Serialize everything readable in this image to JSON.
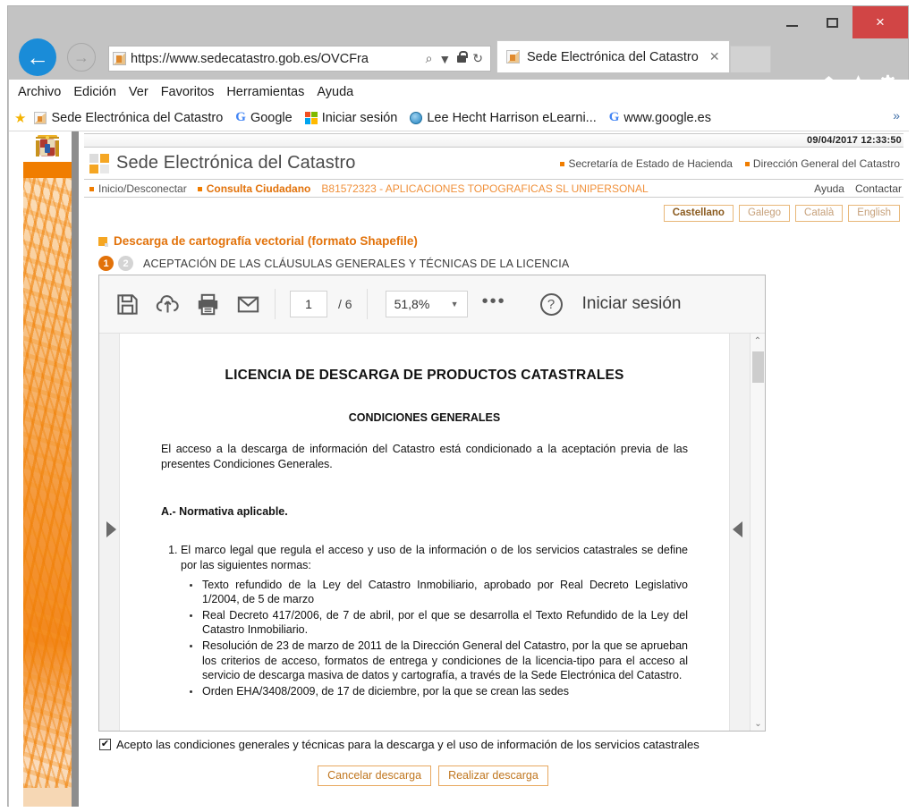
{
  "window": {
    "minimize_label": "minimize",
    "maximize_label": "maximize",
    "close_label": "×"
  },
  "browser": {
    "back_glyph": "←",
    "forward_glyph": "→",
    "address_value": "https://www.sedecatastro.gob.es/OVCFra",
    "address_placeholder": "",
    "search_glyph": "⌕",
    "caret_glyph": "▼",
    "refresh_glyph": "↻",
    "tab": {
      "title": "Sede Electrónica del Catastro",
      "close_glyph": "✕"
    },
    "tools": {
      "home_label": "Inicio",
      "favorites_label": "Favoritos",
      "settings_label": "Herramientas"
    },
    "menu": [
      "Archivo",
      "Edición",
      "Ver",
      "Favoritos",
      "Herramientas",
      "Ayuda"
    ],
    "bookmarks": [
      {
        "label": "Sede Electrónica del Catastro",
        "icon": "catastro-icon"
      },
      {
        "label": "Google",
        "icon": "google-icon"
      },
      {
        "label": "Iniciar sesión",
        "icon": "microsoft-icon"
      },
      {
        "label": "Lee Hecht Harrison eLearni...",
        "icon": "ie-icon"
      },
      {
        "label": "www.google.es",
        "icon": "google-icon"
      }
    ],
    "bookmarks_overflow_glyph": "»"
  },
  "page": {
    "datetime": "09/04/2017  12:33:50",
    "brand_title": "Sede Electrónica del Catastro",
    "brand_links": [
      "Secretaría de Estado de Hacienda",
      "Dirección General del Catastro"
    ],
    "nav": {
      "inicio": "Inicio/Desconectar",
      "consulta": "Consulta Ciudadano",
      "nif": "B81572323 - APLICACIONES TOPOGRAFICAS SL UNIPERSONAL",
      "ayuda": "Ayuda",
      "contactar": "Contactar"
    },
    "languages": [
      {
        "label": "Castellano",
        "active": true
      },
      {
        "label": "Galego",
        "active": false
      },
      {
        "label": "Català",
        "active": false
      },
      {
        "label": "English",
        "active": false
      }
    ],
    "title": "Descarga de cartografía vectorial (formato Shapefile)",
    "steps": [
      {
        "number": "1",
        "active": true
      },
      {
        "number": "2",
        "active": false
      }
    ],
    "step_label": "ACEPTACIÓN DE LAS CLÁUSULAS GENERALES Y TÉCNICAS DE LA LICENCIA",
    "accept_checkbox": {
      "checked": true,
      "check_glyph": "✔",
      "label": "Acepto las condiciones generales y técnicas para la descarga y el uso de información de los servicios catastrales"
    },
    "buttons": [
      {
        "label": "Cancelar descarga"
      },
      {
        "label": "Realizar descarga"
      }
    ]
  },
  "pdf_viewer": {
    "toolbar": {
      "save_icon": "save-icon",
      "upload_icon": "upload-cloud-icon",
      "print_icon": "print-icon",
      "email_icon": "email-icon",
      "page_value": "1",
      "page_total": "/ 6",
      "zoom_value": "51,8%",
      "zoom_caret": "▼",
      "more_glyph": "•••",
      "help_glyph": "?",
      "signin_label": "Iniciar sesión"
    },
    "scroll": {
      "up_glyph": "⌃",
      "down_glyph": "⌄"
    },
    "document": {
      "heading": "LICENCIA DE DESCARGA DE PRODUCTOS CATASTRALES",
      "subheading": "CONDICIONES GENERALES",
      "intro": "El acceso a la descarga de información del Catastro está condicionado a la aceptación previa de las presentes Condiciones Generales.",
      "section_a": "A.- Normativa aplicable.",
      "item1": "El marco legal que regula el acceso y uso de la información o de los servicios catastrales se define por las siguientes normas:",
      "bullets": [
        "Texto refundido de la Ley del Catastro Inmobiliario, aprobado por Real Decreto Legislativo 1/2004, de 5 de marzo",
        "Real Decreto 417/2006, de 7 de abril, por el que se desarrolla el Texto Refundido de la Ley del Catastro Inmobiliario.",
        "Resolución de 23 de marzo de 2011 de la Dirección General del Catastro, por la que se aprueban los criterios de acceso, formatos de entrega y condiciones de la licencia-tipo para el acceso al servicio de descarga masiva de datos y cartografía, a través de la Sede Electrónica del Catastro.",
        "Orden EHA/3408/2009, de 17 de diciembre, por la que se crean las sedes"
      ]
    }
  },
  "colors": {
    "accent_orange": "#e2720a",
    "logo_orange": "#f5a623",
    "rail_orange": "#f07d00",
    "close_red": "#d14545",
    "back_blue": "#1a8cd8"
  }
}
